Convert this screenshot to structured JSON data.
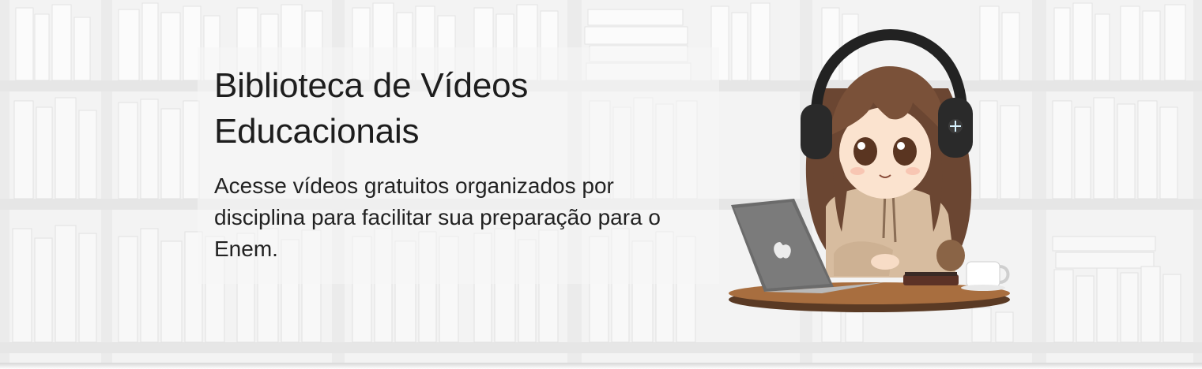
{
  "hero": {
    "title_line1": "Biblioteca de Vídeos",
    "title_line2": "Educacionais",
    "subtitle": "Acesse vídeos gratuitos organizados por disciplina para facilitar sua preparação para o Enem.",
    "background": "bookshelf-background",
    "illustration": "girl-with-headphones-and-laptop-illustration"
  },
  "colors": {
    "background": "#f4f4f4",
    "text": "#1d1d1d",
    "hair": "#6e4a35",
    "hoodie": "#d9bfa3"
  }
}
